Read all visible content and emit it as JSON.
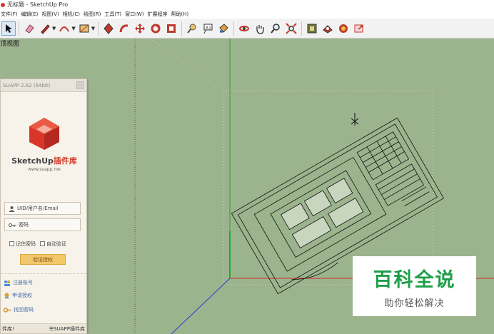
{
  "window": {
    "title": "无标题 - SketchUp Pro"
  },
  "menu": [
    "文件(F)",
    "编辑(E)",
    "视图(V)",
    "相机(C)",
    "绘图(R)",
    "工具(T)",
    "窗口(W)",
    "扩展程序",
    "帮助(H)"
  ],
  "toolbar": {
    "tools": [
      "select-tool",
      "eraser-tool",
      "line-tool",
      "arc-tool",
      "rectangle-tool",
      "push-pull-tool",
      "follow-me-tool",
      "move-tool",
      "rotate-tool",
      "offset-tool",
      "tape-measure-tool",
      "text-tool",
      "paint-bucket-tool",
      "orbit-tool",
      "pan-tool",
      "zoom-tool",
      "zoom-extents-tool",
      "warehouse-tool",
      "extension-warehouse-tool",
      "layout-tool",
      "share-tool"
    ]
  },
  "viewport": {
    "scene_label": "顶视图"
  },
  "plugin": {
    "title": "SUAPP 2.62 (64bit)",
    "logo_text": "SketchUp",
    "logo_accent": "插件库",
    "logo_url": "www.suapp.me",
    "uid_placeholder": "UID/用户名/Email",
    "password_placeholder": "密码",
    "remember_label": "记住密码",
    "autoverify_label": "自动验证",
    "verify_button": "验证授权",
    "register_link": "注册账号",
    "apply_link": "申请授权",
    "recover_link": "找回密码",
    "footer_left": "件库!",
    "footer_right": "SUAPP插件库"
  },
  "watermark": {
    "main": "百科全说",
    "sub": "助你轻松解决"
  },
  "colors": {
    "viewport_bg": "#9cb48e",
    "accent_red": "#d43a2a",
    "watermark_green": "#1e9e4a",
    "verify_button": "#f2c86a"
  }
}
